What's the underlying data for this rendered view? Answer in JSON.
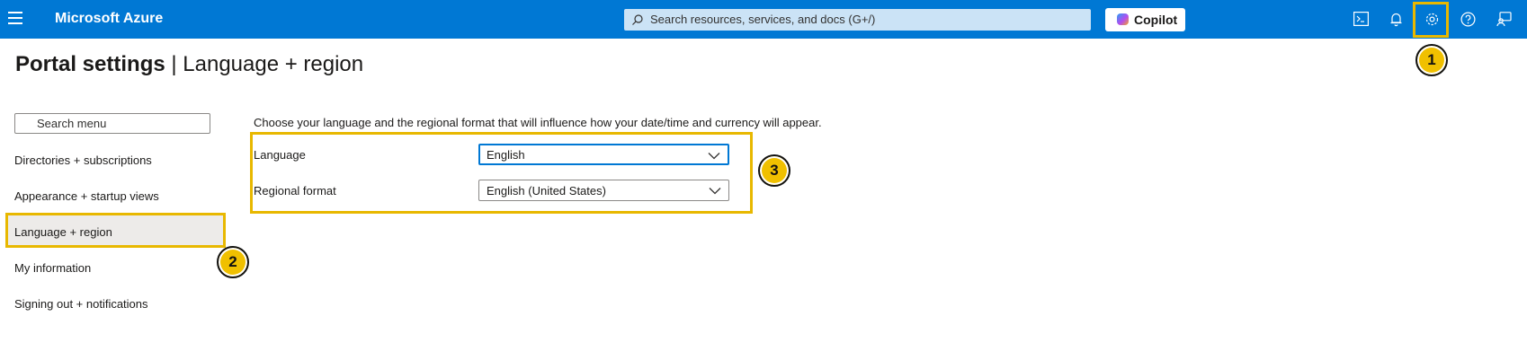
{
  "topbar": {
    "brand": "Microsoft Azure",
    "search_placeholder": "Search resources, services, and docs (G+/)",
    "copilot_label": "Copilot",
    "icons": [
      "cloud-shell-icon",
      "notifications-icon",
      "settings-icon",
      "help-icon",
      "feedback-icon"
    ]
  },
  "page": {
    "title_bold": "Portal settings",
    "title_separator": " | ",
    "title_rest": "Language + region"
  },
  "sidebar": {
    "search_placeholder": "Search menu",
    "items": [
      {
        "label": "Directories + subscriptions"
      },
      {
        "label": "Appearance + startup views"
      },
      {
        "label": "Language + region",
        "active": true
      },
      {
        "label": "My information"
      },
      {
        "label": "Signing out + notifications"
      }
    ]
  },
  "content": {
    "description": "Choose your language and the regional format that will influence how your date/time and currency will appear.",
    "language_label": "Language",
    "language_value": "English",
    "region_label": "Regional format",
    "region_value": "English (United States)"
  },
  "annotations": {
    "badge_1": "1",
    "badge_2": "2",
    "badge_3": "3",
    "highlight_color": "#e8b800"
  },
  "colors": {
    "accent": "#0078d4",
    "search_bg": "#cbe3f6",
    "active_item_bg": "#edebe9"
  }
}
